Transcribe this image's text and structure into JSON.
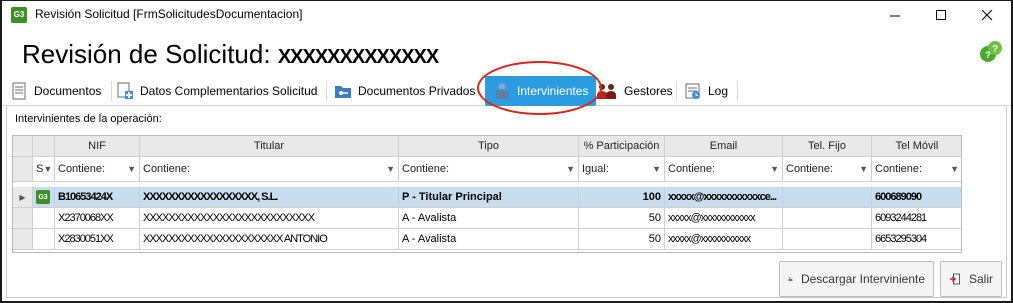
{
  "window": {
    "title": "Revisión Solicitud [FrmSolicitudesDocumentacion]",
    "app_badge": "G3",
    "min_glyph": "─",
    "max_glyph": "☐",
    "close_glyph": "✕"
  },
  "header": {
    "title": "Revisión de Solicitud: ",
    "masked_id": "XXXXXXXXXXXXX"
  },
  "tabs": [
    {
      "label": "Documentos",
      "icon": "document-icon"
    },
    {
      "label": "Datos Complementarios Solicitud",
      "icon": "document-plus-icon"
    },
    {
      "label": "Documentos Privados",
      "icon": "folder-key-icon"
    },
    {
      "label": "Intervinientes",
      "icon": "person-icon",
      "active": true
    },
    {
      "label": "Gestores",
      "icon": "users-icon"
    },
    {
      "label": "Log",
      "icon": "log-icon"
    }
  ],
  "section_label": "Intervinientes de la operación:",
  "grid": {
    "columns": [
      "NIF",
      "Titular",
      "Tipo",
      "% Participación",
      "Email",
      "Tel. Fijo",
      "Tel Móvil"
    ],
    "status_col": "S",
    "filters": {
      "nif": "Contiene:",
      "titular": "Contiene:",
      "tipo": "Contiene:",
      "participacion": "Igual:",
      "email": "Contiene:",
      "tel_fijo": "Contiene:",
      "tel_movil": "Contiene:"
    },
    "rows": [
      {
        "nif": "B10653424X",
        "titular": "XXXXXXXXXXXXXXXXXX, S.L.",
        "tipo": "P - Titular Principal",
        "participacion": "100",
        "email": "xxxxx@xxxxxxxxxxxce...",
        "tel_fijo": "",
        "tel_movil": "600689090",
        "badge": "G3"
      },
      {
        "nif": "X2370068XX",
        "titular": "XXXXXXXXXXXXXXXXXXXXXXXXXXX",
        "tipo": "A - Avalista",
        "participacion": "50",
        "email": "xxxxx@xxxxxxxxxxxx",
        "tel_fijo": "",
        "tel_movil": "6093244281",
        "badge": ""
      },
      {
        "nif": "X2830051XX",
        "titular": "XXXXXXXXXXXXXXXXXXXXXX ANTONIO",
        "tipo": "A - Avalista",
        "participacion": "50",
        "email": "xxxxx@xxxxxxxxxxx",
        "tel_fijo": "",
        "tel_movil": "6653295304",
        "badge": ""
      }
    ]
  },
  "buttons": {
    "download": "Descargar Interviniente",
    "exit": "Salir"
  },
  "colors": {
    "active_tab": "#2b9ce0",
    "selected_row": "#c9ddf0",
    "highlight_oval": "#d9261c",
    "app_icon": "#3e8e2a"
  }
}
